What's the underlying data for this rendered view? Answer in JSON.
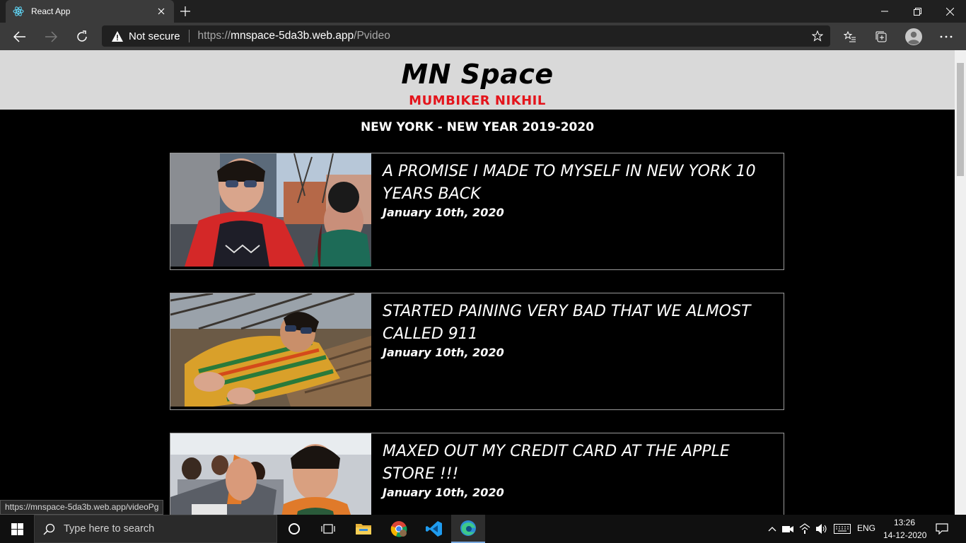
{
  "browser": {
    "tab_title": "React App",
    "security_label": "Not secure",
    "url_scheme": "https://",
    "url_host": "mnspace-5da3b.web.app",
    "url_path": "/Pvideo",
    "status_link": "https://mnspace-5da3b.web.app/videoPg"
  },
  "site": {
    "brand": "MN Space",
    "tagline": "MUMBIKER NIKHIL",
    "section_title": "NEW YORK - NEW YEAR 2019-2020"
  },
  "videos": [
    {
      "title": "A PROMISE I MADE TO MYSELF IN NEW YORK 10 YEARS BACK",
      "date": "January 10th, 2020"
    },
    {
      "title": "STARTED PAINING VERY BAD THAT WE ALMOST CALLED 911",
      "date": "January 10th, 2020"
    },
    {
      "title": "MAXED OUT MY CREDIT CARD AT THE APPLE STORE !!!",
      "date": "January 10th, 2020"
    }
  ],
  "taskbar": {
    "search_placeholder": "Type here to search",
    "language": "ENG",
    "time": "13:26",
    "date": "14-12-2020"
  },
  "colors": {
    "tagline_red": "#e4141b",
    "header_bg": "#d9d9d9",
    "page_bg": "#000000"
  }
}
